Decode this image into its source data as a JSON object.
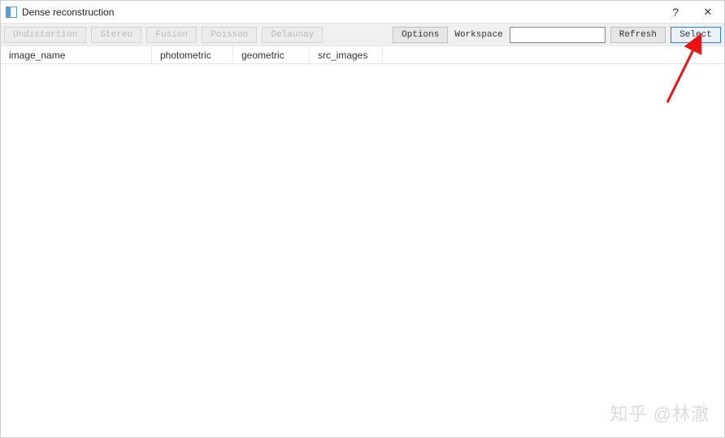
{
  "title": "Dense reconstruction",
  "titlebar": {
    "help": "?",
    "close": "✕"
  },
  "toolbar": {
    "left": {
      "undistortion": "Undistortion",
      "stereo": "Stereo",
      "fusion": "Fusion",
      "poisson": "Poisson",
      "delaunay": "Delaunay"
    },
    "right": {
      "options": "Options",
      "workspace_label": "Workspace",
      "workspace_value": "",
      "refresh": "Refresh",
      "select": "Select"
    }
  },
  "table": {
    "headers": {
      "image_name": "image_name",
      "photometric": "photometric",
      "geometric": "geometric",
      "src_images": "src_images"
    },
    "rows": []
  },
  "watermark": "知乎 @林澈"
}
